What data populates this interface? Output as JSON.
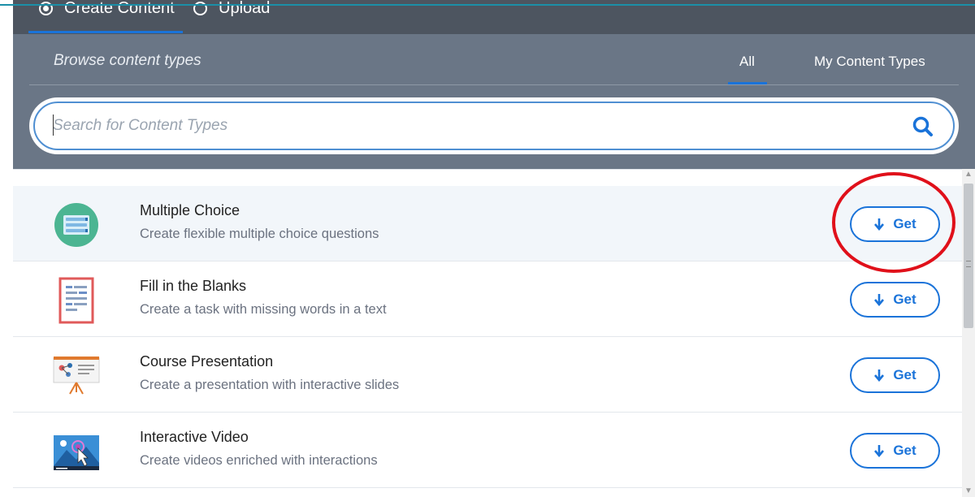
{
  "tabs": [
    {
      "label": "Create Content",
      "selected": true
    },
    {
      "label": "Upload",
      "selected": false
    }
  ],
  "browse": {
    "title": "Browse content types",
    "filters": [
      {
        "label": "All",
        "active": true
      },
      {
        "label": "My Content Types",
        "active": false
      }
    ]
  },
  "search": {
    "placeholder": "Search for Content Types",
    "value": "",
    "icon": "search-icon"
  },
  "content_types": [
    {
      "title": "Multiple Choice",
      "description": "Create flexible multiple choice questions",
      "button_label": "Get",
      "icon": "multiple-choice-icon",
      "highlighted": true
    },
    {
      "title": "Fill in the Blanks",
      "description": "Create a task with missing words in a text",
      "button_label": "Get",
      "icon": "fill-in-the-blanks-icon",
      "highlighted": false
    },
    {
      "title": "Course Presentation",
      "description": "Create a presentation with interactive slides",
      "button_label": "Get",
      "icon": "course-presentation-icon",
      "highlighted": false
    },
    {
      "title": "Interactive Video",
      "description": "Create videos enriched with interactions",
      "button_label": "Get",
      "icon": "interactive-video-icon",
      "highlighted": false
    }
  ],
  "colors": {
    "accent": "#1a73d9",
    "header_bg": "#6a7686",
    "tabs_bg": "#4d5560",
    "highlight_ring": "#e0101a"
  }
}
